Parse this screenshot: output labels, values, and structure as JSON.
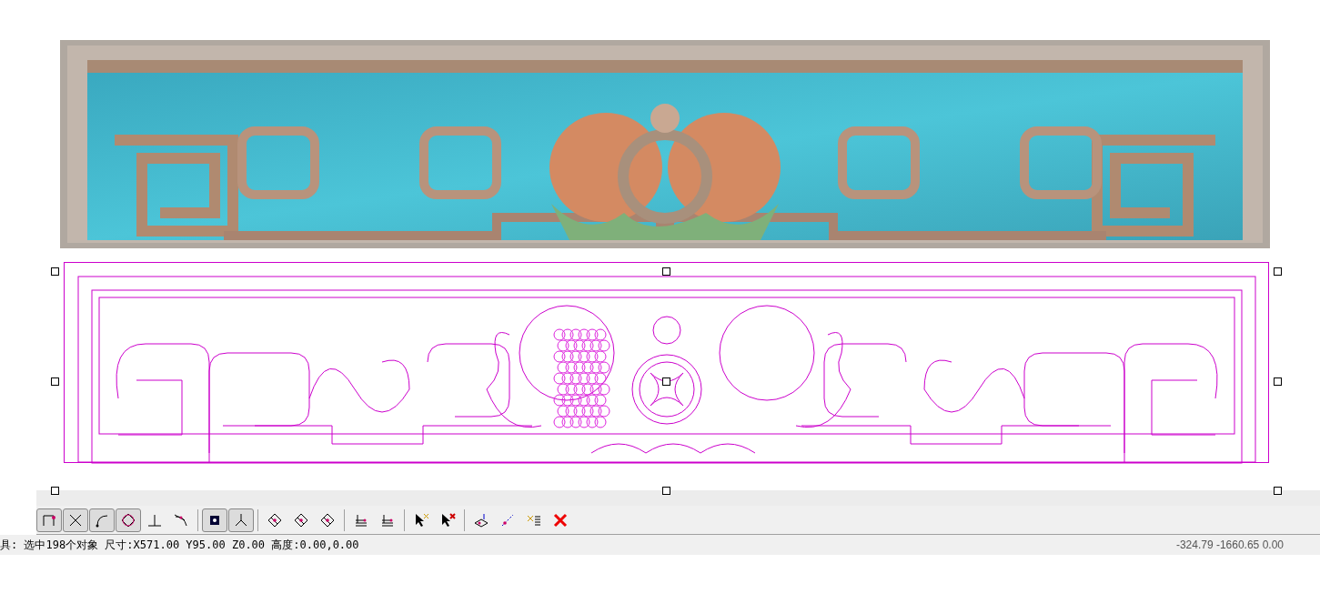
{
  "toolbar": {
    "groups": [
      [
        {
          "kind": "corner",
          "pressed": true
        },
        {
          "kind": "cross",
          "pressed": true
        },
        {
          "kind": "arc",
          "pressed": true
        },
        {
          "kind": "circle",
          "pressed": true
        },
        {
          "kind": "perpendicular",
          "pressed": false
        },
        {
          "kind": "tangent",
          "pressed": false
        }
      ],
      [
        {
          "kind": "center",
          "pressed": true
        },
        {
          "kind": "axes",
          "pressed": true
        }
      ],
      [
        {
          "kind": "diamond",
          "pressed": false
        },
        {
          "kind": "diamond",
          "pressed": false
        },
        {
          "kind": "diamond",
          "pressed": false
        }
      ],
      [
        {
          "kind": "layers",
          "pressed": false
        },
        {
          "kind": "layers",
          "pressed": false
        }
      ],
      [
        {
          "kind": "cursor",
          "pressed": false
        },
        {
          "kind": "cursor-x",
          "pressed": false
        }
      ],
      [
        {
          "kind": "plane",
          "pressed": false
        },
        {
          "kind": "link",
          "pressed": false
        },
        {
          "kind": "list",
          "pressed": false
        },
        {
          "kind": "delete",
          "pressed": false
        }
      ]
    ]
  },
  "status_bar": {
    "message": "具: 选中198个对象 尺寸:X571.00 Y95.00 Z0.00 高度:0.00,0.00",
    "coordinates": "-324.79 -1660.65 0.00"
  }
}
